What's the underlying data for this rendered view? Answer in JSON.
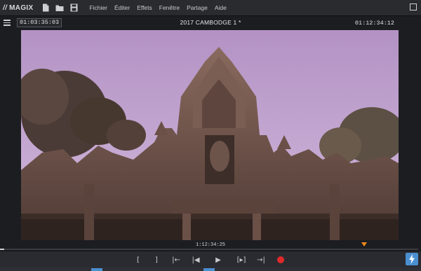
{
  "app": {
    "brand": "MAGIX",
    "brand_mark": "//",
    "menu": [
      "Fichier",
      "Éditer",
      "Effets",
      "Fenêtre",
      "Partage",
      "Aide"
    ],
    "file_icons": [
      "new-file-icon",
      "open-folder-icon",
      "save-icon"
    ]
  },
  "player": {
    "timecode_left": "01:03:35:03",
    "project_title": "2017 CAMBODGE 1 *",
    "timecode_right": "01:12:34:12"
  },
  "scrub": {
    "timecode": "1:12:34:25",
    "position_fraction": 0.87
  },
  "transport": {
    "mark_in": "[",
    "mark_out": "]",
    "prev_marker": "|←",
    "prev_frame": "|◀",
    "play": "▶",
    "next_frame": "[▸]",
    "next_marker": "→|",
    "record_color": "#e02a2a"
  },
  "colors": {
    "accent": "#4a8fd0",
    "playhead": "#f08a1c",
    "background": "#1c1d21"
  }
}
